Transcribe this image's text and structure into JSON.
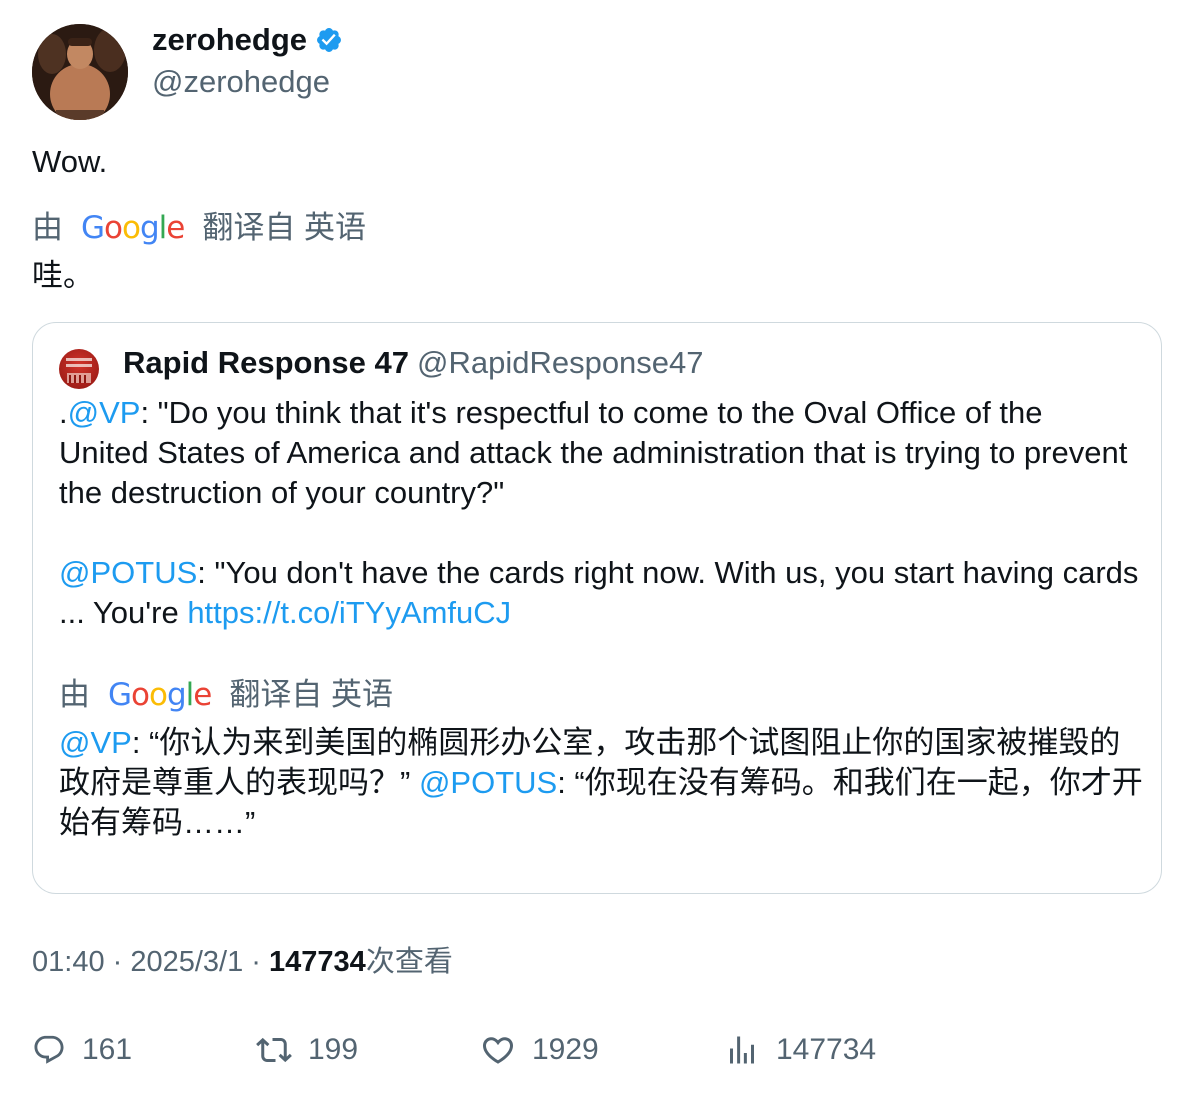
{
  "author": {
    "display_name": "zerohedge",
    "handle": "@zerohedge"
  },
  "tweet": {
    "text": "Wow.",
    "translate_prefix": "由",
    "translate_logo": "Google",
    "translate_suffix": "翻译自 英语",
    "translated_text": "哇。"
  },
  "quote": {
    "display_name": "Rapid Response 47",
    "handle": "@RapidResponse47",
    "p1_prefix": ".",
    "p1_mention": "@VP",
    "p1_text": ": \"Do you think that it's respectful to come to the Oval Office of the United States of America and attack the administration that is trying to prevent the destruction of your country?\"",
    "p2_mention": "@POTUS",
    "p2_text": ": \"You don't have the cards right now. With us, you start having cards ... You're ",
    "p2_link": "https://t.co/iTYyAmfuCJ",
    "translate_prefix": "由",
    "translate_logo": "Google",
    "translate_suffix": "翻译自 英语",
    "tr_mention1": "@VP",
    "tr_text1": ": “你认为来到美国的椭圆形办公室，攻击那个试图阻止你的国家被摧毁的政府是尊重人的表现吗？” ",
    "tr_mention2": "@POTUS",
    "tr_text2": ": “你现在没有筹码。和我们在一起，你才开始有筹码……”"
  },
  "meta": {
    "time": "01:40",
    "sep1": " · ",
    "date": "2025/3/1",
    "sep2": " · ",
    "views": "147734",
    "views_suffix": "次查看"
  },
  "actions": {
    "replies": "161",
    "reposts": "199",
    "likes": "1929",
    "views": "147734"
  },
  "colors": {
    "accent": "#1d9bf0",
    "secondary_text": "#536471",
    "border": "#cfd9de"
  },
  "icons": [
    "verified-badge-icon",
    "reply-icon",
    "repost-icon",
    "like-icon",
    "views-icon"
  ]
}
